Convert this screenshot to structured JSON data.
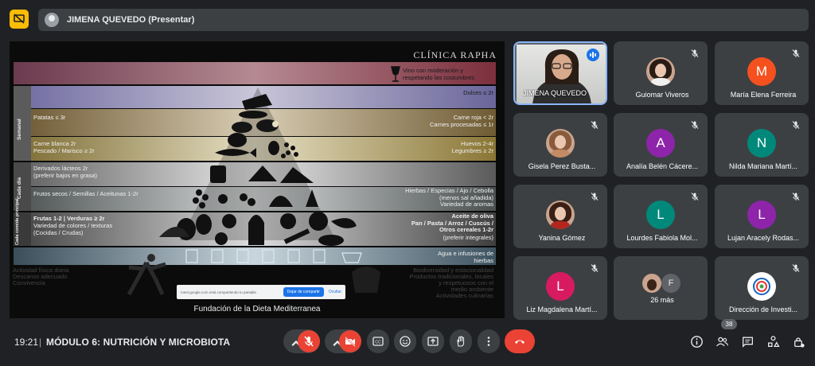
{
  "presenter_bar": {
    "label": "JIMENA QUEVEDO (Presentar)"
  },
  "slide": {
    "brand": "CLÍNICA RAPHA",
    "footer": "Fundación de la Dieta Mediterranea",
    "wine": "Vino con moderación y\nrespetando las costumbres",
    "side_labels": {
      "weekly": "Semanal",
      "daily": "Cada día",
      "meal": "Cada comida principal"
    },
    "rows": {
      "sweets": "Dulces ≤ 2r",
      "potatoes": "Patatas ≤ 3r",
      "red_meat": "Carne roja < 2r\nCarnes procesadas ≤ 1r",
      "white_meat": "Carne blanca 2r\nPescado / Marisco ≥ 2r",
      "eggs": "Huevos 2-4r\nLegumbres ≥ 2r",
      "dairy": "Derivados lácteos 2r\n(preferir bajos en grasa)",
      "nuts": "Frutos secos / Semillas / Aceitunas 1-2r",
      "herbs": "Hierbas / Especias / Ajo / Cebolla\n(menos sal añadida)\nVariedad de aromas",
      "fruits": "Frutas 1-2 | Verduras ≥ 2r",
      "fruits_sub": "Variedad de colores / texturas\n(Cocidas / Crudas)",
      "oil": "Aceite de oliva\nPan / Pasta / Arroz / Cuscús /\nOtros cereales 1-2r",
      "oil_sub": "(preferir integrales)",
      "water": "Agua e infusiones de\nhierbas",
      "activity": "Actividad física diaria\nDescanso adecuado\nConvivencia",
      "biodiversity": "Biodiversidad y estacionalidad\nProductos tradicionales, locales\ny respetuosos con el\nmedio ambiente\nActividades culinarias"
    },
    "share_bar": {
      "text": "meet.google.com está compartiendo tu pantalla",
      "button": "Dejar de compartir",
      "hide": "Ocultar"
    }
  },
  "participants": [
    {
      "name": "JIMENA QUEVEDO",
      "type": "video",
      "speaking": true
    },
    {
      "name": "Guiomar Viveros",
      "type": "photo",
      "muted": true,
      "hair": "#2a1c14",
      "body": "#f0f0f0"
    },
    {
      "name": "María Elena Ferreira",
      "type": "letter",
      "letter": "M",
      "color": "#f4511e",
      "muted": true
    },
    {
      "name": "Gisela Perez Busta...",
      "type": "photo",
      "muted": true,
      "hair": "#8a5a3c",
      "body": "#c48a64"
    },
    {
      "name": "Analía Belén Cácere...",
      "type": "letter",
      "letter": "A",
      "color": "#8e24aa",
      "muted": true
    },
    {
      "name": "Nilda Mariana Martí...",
      "type": "letter",
      "letter": "N",
      "color": "#00897b",
      "muted": true
    },
    {
      "name": "Yanina Gómez",
      "type": "photo",
      "muted": true,
      "hair": "#3a1f16",
      "body": "#b3261e"
    },
    {
      "name": "Lourdes Fabiola Mol...",
      "type": "letter",
      "letter": "L",
      "color": "#00897b",
      "muted": true
    },
    {
      "name": "Lujan Aracely Rodas...",
      "type": "letter",
      "letter": "L",
      "color": "#8e24aa",
      "muted": true
    },
    {
      "name": "Liz Magdalena Martí...",
      "type": "letter",
      "letter": "L",
      "color": "#d81b60",
      "muted": true
    },
    {
      "name": "26 más",
      "type": "more",
      "letter": "F"
    },
    {
      "name": "Dirección de Investi...",
      "type": "logo",
      "muted": true
    }
  ],
  "bottom_bar": {
    "time": "19:21",
    "separator": "|",
    "meeting_title": "MÓDULO 6: NUTRICIÓN Y MICROBIOTA",
    "participant_count": "38"
  },
  "colors": {
    "background": "#202124",
    "tile": "#3c4043",
    "danger": "#ea4335",
    "accent": "#8ab4f8",
    "present": "#fbbc04"
  },
  "icons": [
    "present-icon",
    "mic-off-icon",
    "camera-off-icon",
    "captions-icon",
    "emoji-icon",
    "present-screen-icon",
    "raise-hand-icon",
    "more-icon",
    "end-call-icon",
    "info-icon",
    "people-icon",
    "chat-icon",
    "activities-icon",
    "host-controls-icon"
  ]
}
